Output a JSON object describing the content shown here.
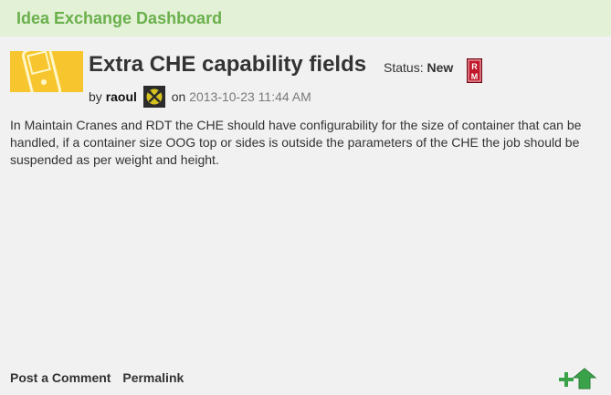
{
  "header": {
    "title": "Idea Exchange Dashboard"
  },
  "idea": {
    "title": "Extra CHE capability fields",
    "status_label": "Status:",
    "status_value": "New",
    "status_badge_text": "RM",
    "by_label": "by",
    "author": "raoul",
    "on_label": "on",
    "date": "2013-10-23 11:44 AM",
    "body": "In Maintain Cranes and RDT the CHE should have configurability for the size of container that can be handled, if a container size OOG top or sides is outside the parameters of the CHE the job should be suspended as per weight and height."
  },
  "footer": {
    "post_comment_label": "Post a Comment",
    "permalink_label": "Permalink"
  },
  "icons": {
    "thumbnail": "device-thumbnail-icon",
    "status_badge": "rm-badge-icon",
    "avatar": "crossed-tools-avatar-icon",
    "vote": "plus-arrow-vote-icon"
  },
  "colors": {
    "header_bg": "#e3f1d6",
    "header_text": "#6ab04c",
    "page_bg": "#f1f1f1",
    "badge_red": "#c0182a",
    "vote_green": "#3aa34a"
  }
}
